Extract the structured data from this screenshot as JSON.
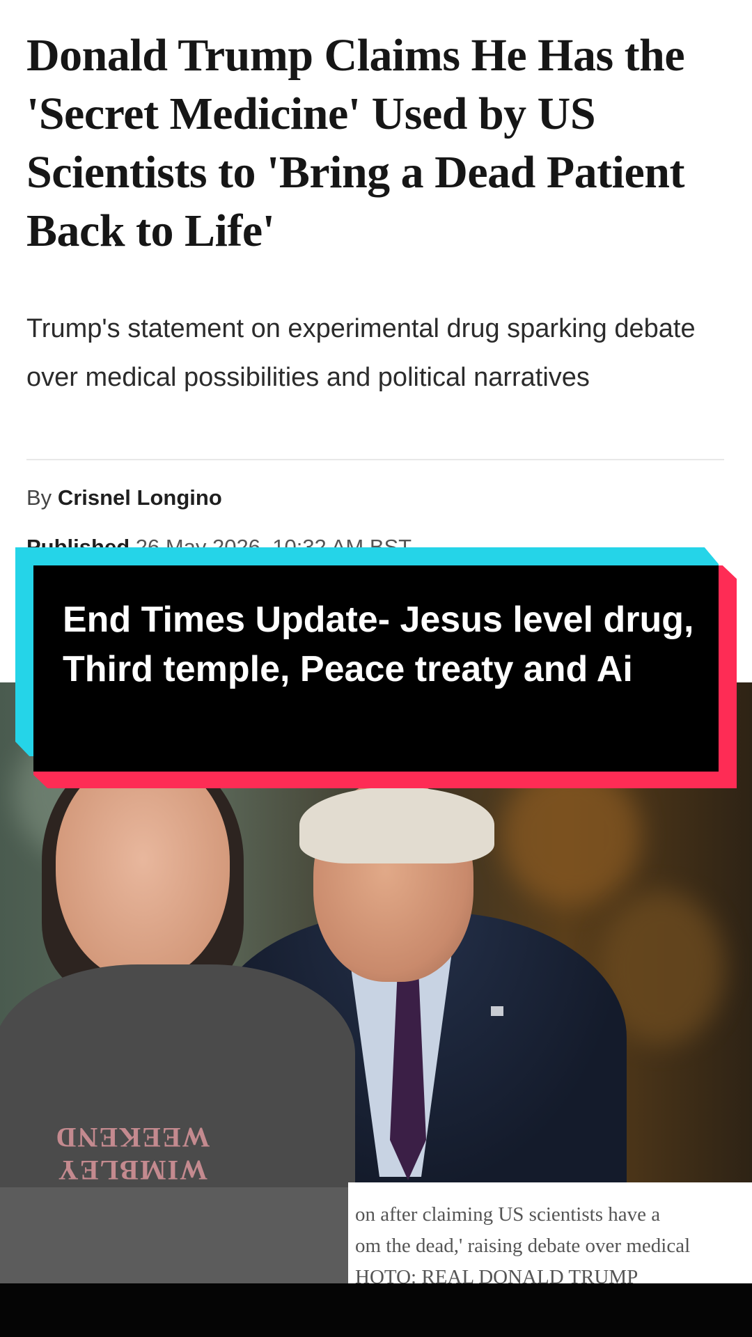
{
  "article": {
    "headline": "Donald Trump Claims He Has the 'Secret Medicine' Used by US Scientists to 'Bring a Dead Patient Back to Life'",
    "subheadline": "Trump's statement on experimental drug sparking debate over medical possibilities and political narratives",
    "byline_prefix": "By",
    "author": "Crisnel Longino",
    "published_label": "Published",
    "published_date": "26 May 2026, 10:32 AM BST"
  },
  "photo_caption": {
    "line1": "on after claiming US scientists have a",
    "line2": "om the dead,' raising debate over medical",
    "line3": "HOTO: REAL DONALD TRUMP"
  },
  "overlay": {
    "title": "End Times Update- Jesus level drug, Third temple, Peace treaty and Ai"
  },
  "shirt_print": "WIMBLEY WEEKEND",
  "colors": {
    "accent_cyan": "#25d4e8",
    "accent_red": "#fe2c55",
    "card_bg": "#000000"
  }
}
